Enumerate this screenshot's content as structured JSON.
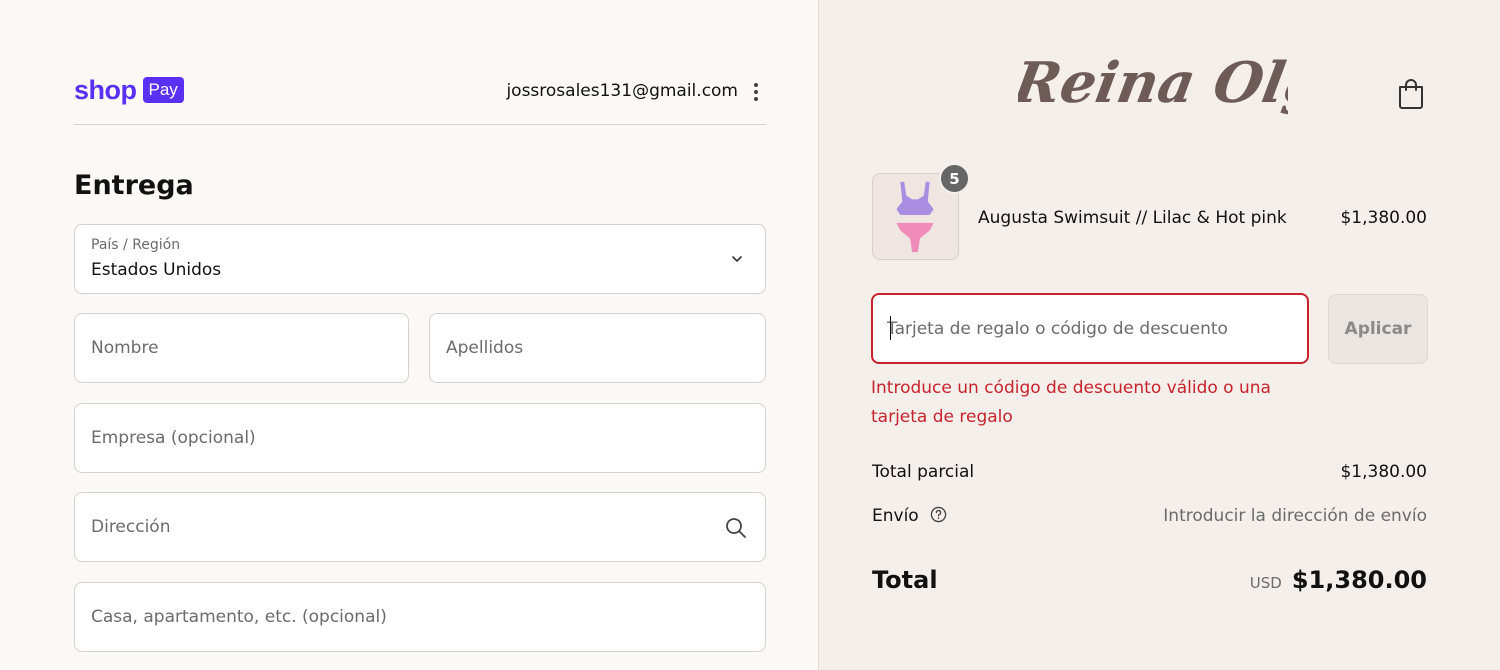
{
  "header": {
    "brand_word": "shop",
    "brand_badge": "Pay",
    "account_email": "jossrosales131@gmail.com"
  },
  "delivery": {
    "title": "Entrega",
    "country_label": "País / Región",
    "country_value": "Estados Unidos",
    "first_name_placeholder": "Nombre",
    "last_name_placeholder": "Apellidos",
    "company_placeholder": "Empresa (opcional)",
    "address_placeholder": "Dirección",
    "apartment_placeholder": "Casa, apartamento, etc. (opcional)"
  },
  "store": {
    "logo_text": "Reina Olga"
  },
  "cart": {
    "item_quantity": "5",
    "item_name": "Augusta Swimsuit // Lilac & Hot pink",
    "item_price": "$1,380.00"
  },
  "discount": {
    "placeholder": "Tarjeta de regalo o código de descuento",
    "apply_label": "Aplicar",
    "error_message": "Introduce un código de descuento válido o una tarjeta de regalo"
  },
  "summary": {
    "subtotal_label": "Total parcial",
    "subtotal_value": "$1,380.00",
    "shipping_label": "Envío",
    "shipping_value": "Introducir la dirección de envío",
    "total_label": "Total",
    "currency": "USD",
    "total_value": "$1,380.00"
  },
  "colors": {
    "shop_pay_purple": "#5a31f4",
    "error_red": "#c8232c",
    "logo_brown": "#6e5a57"
  },
  "icons": [
    "kebab-menu-icon",
    "chevron-down-icon",
    "search-icon",
    "shopping-bag-icon",
    "help-circle-icon"
  ]
}
